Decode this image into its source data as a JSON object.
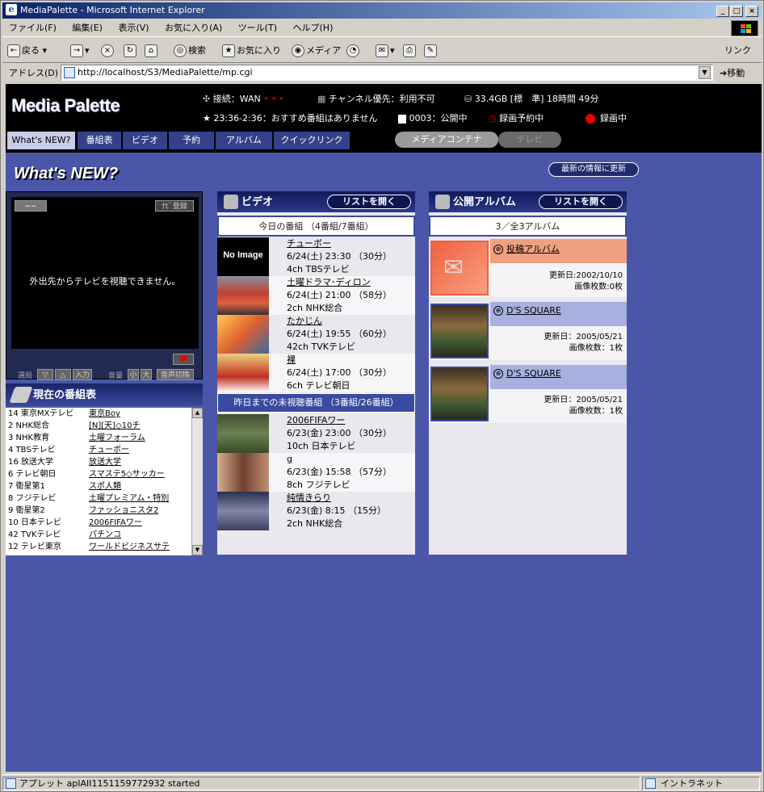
{
  "window": {
    "title": "MediaPalette - Microsoft Internet Explorer"
  },
  "menu": [
    "ファイル(F)",
    "編集(E)",
    "表示(V)",
    "お気に入り(A)",
    "ツール(T)",
    "ヘルプ(H)"
  ],
  "toolbar": {
    "back": "戻る",
    "search": "検索",
    "favorites": "お気に入り",
    "media": "メディア",
    "links": "リンク"
  },
  "address": {
    "label": "アドレス(D)",
    "url": "http://localhost/S3/MediaPalette/mp.cgi",
    "go": "移動"
  },
  "header": {
    "logo": "Media Palette",
    "connection": "接続：WAN",
    "channel": "チャンネル優先：利用不可",
    "disk": "33.4GB [標　準] 18時間 49分",
    "recommend": "23:36-2:36：おすすめ番組はありません",
    "public": "0003：公開中",
    "reserve": "録画予約中",
    "recording": "録画中"
  },
  "tabs": [
    "What's NEW?",
    "番組表",
    "ビデオ",
    "予約",
    "アルバム",
    "クイックリンク"
  ],
  "pills": {
    "media": "メディアコンテナ",
    "tv": "テレビ"
  },
  "page": {
    "title": "What's NEW?",
    "refresh": "最新の情報に更新"
  },
  "tvpanel": {
    "channel": "−−",
    "niban": "ﾅﾋﾞ登録",
    "message": "外出先からテレビを視聴できません。",
    "select": "選局",
    "input": "入力",
    "volume": "音量",
    "vol_small": "小",
    "vol_large": "大",
    "audio": "音声切換"
  },
  "guide": {
    "title": "現在の番組表",
    "rows": [
      {
        "ch": "14 東京MXテレビ",
        "prog": "東京Boy"
      },
      {
        "ch": " 2 NHK総合",
        "prog": "[N][天]◇10チ"
      },
      {
        "ch": " 3 NHK教育",
        "prog": "土曜フォーラム"
      },
      {
        "ch": " 4 TBSテレビ",
        "prog": "チューボー"
      },
      {
        "ch": "16 放送大学",
        "prog": "放送大学"
      },
      {
        "ch": " 6 テレビ朝日",
        "prog": "スマステ5◇サッカー"
      },
      {
        "ch": " 7 衛星第1",
        "prog": "スポ人類"
      },
      {
        "ch": " 8 フジテレビ",
        "prog": "土曜プレミアム・特別"
      },
      {
        "ch": " 9 衛星第2",
        "prog": "ファッショニスタ2"
      },
      {
        "ch": "10 日本テレビ",
        "prog": "2006FIFAワー"
      },
      {
        "ch": "42 TVKテレビ",
        "prog": "パチンコ"
      },
      {
        "ch": "12 テレビ東京",
        "prog": "ワールドビジネスサテ"
      }
    ]
  },
  "video": {
    "title": "ビデオ",
    "open": "リストを開く",
    "today": "今日の番組 （4番組/7番組）",
    "past": "昨日までの未視聴番組 （3番組/26番組）",
    "today_items": [
      {
        "title": "チューボー",
        "date": "6/24(土) 23:30 （30分）",
        "ch": "4ch TBSテレビ",
        "thumb": "No Image"
      },
      {
        "title": "土曜ドラマ･ディロン",
        "date": "6/24(土) 21:00 （58分）",
        "ch": "2ch NHK総合",
        "thumb": ""
      },
      {
        "title": "たかじん",
        "date": "6/24(土) 19:55 （60分）",
        "ch": "42ch TVKテレビ",
        "thumb": ""
      },
      {
        "title": "裸",
        "date": "6/24(土) 17:00 （30分）",
        "ch": "6ch テレビ朝日",
        "thumb": ""
      }
    ],
    "past_items": [
      {
        "title": "2006FIFAワー",
        "date": "6/23(金) 23:00 （30分）",
        "ch": "10ch 日本テレビ"
      },
      {
        "title": "g",
        "date": "6/23(金) 15:58 （57分）",
        "ch": "8ch フジテレビ"
      },
      {
        "title": "純情きらり",
        "date": "6/23(金) 8:15 （15分）",
        "ch": "2ch NHK総合"
      }
    ]
  },
  "album": {
    "title": "公開アルバム",
    "open": "リストを開く",
    "count": "3／全3アルバム",
    "items": [
      {
        "name": "投稿アルバム",
        "updated": "更新日:2002/10/10",
        "images": "画像枚数:0枚"
      },
      {
        "name": "D'S SQUARE",
        "updated": "更新日：2005/05/21",
        "images": "画像枚数：1枚"
      },
      {
        "name": "D'S SQUARE",
        "updated": "更新日：2005/05/21",
        "images": "画像枚数：1枚"
      }
    ]
  },
  "status": {
    "text": "アプレット apIAII1151159772932 started",
    "zone": "イントラネット"
  }
}
